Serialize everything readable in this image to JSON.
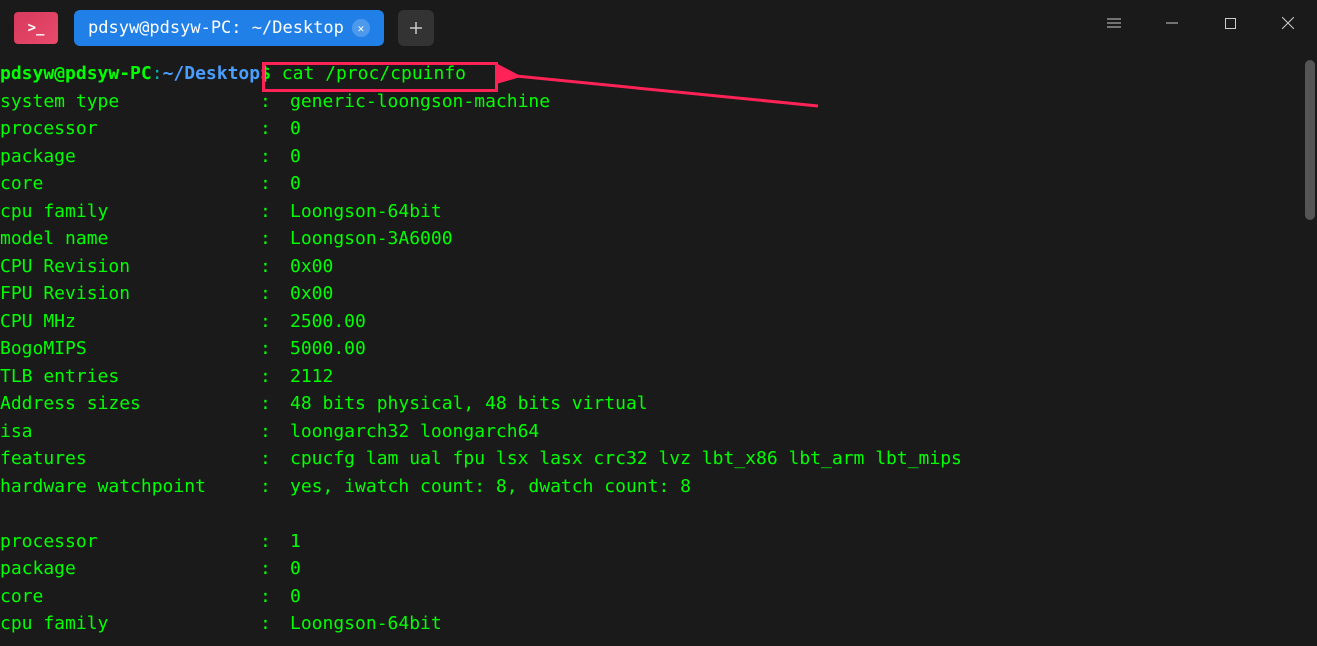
{
  "titlebar": {
    "app_icon_text": ">_",
    "tab_title": "pdsyw@pdsyw-PC: ~/Desktop"
  },
  "prompt": {
    "user": "pdsyw@pdsyw-PC",
    "colon": ":",
    "path": "~/Desktop",
    "dollar": "$",
    "command": " cat /proc/cpuinfo"
  },
  "output_block1": [
    {
      "key": "system type",
      "val": "generic-loongson-machine"
    },
    {
      "key": "processor",
      "val": "0"
    },
    {
      "key": "package",
      "val": "0"
    },
    {
      "key": "core",
      "val": "0"
    },
    {
      "key": "cpu family",
      "val": "Loongson-64bit"
    },
    {
      "key": "model name",
      "val": "Loongson-3A6000"
    },
    {
      "key": "CPU Revision",
      "val": "0x00"
    },
    {
      "key": "FPU Revision",
      "val": "0x00"
    },
    {
      "key": "CPU MHz",
      "val": "2500.00"
    },
    {
      "key": "BogoMIPS",
      "val": "5000.00"
    },
    {
      "key": "TLB entries",
      "val": "2112"
    },
    {
      "key": "Address sizes",
      "val": "48 bits physical, 48 bits virtual"
    },
    {
      "key": "isa",
      "val": "loongarch32 loongarch64"
    },
    {
      "key": "features",
      "val": "cpucfg lam ual fpu lsx lasx crc32 lvz lbt_x86 lbt_arm lbt_mips"
    },
    {
      "key": "hardware watchpoint",
      "val": "yes, iwatch count: 8, dwatch count: 8"
    }
  ],
  "output_block2": [
    {
      "key": "processor",
      "val": "1"
    },
    {
      "key": "package",
      "val": "0"
    },
    {
      "key": "core",
      "val": "0"
    },
    {
      "key": "cpu family",
      "val": "Loongson-64bit"
    }
  ],
  "annotation": {
    "highlight_color": "#ff2257"
  }
}
